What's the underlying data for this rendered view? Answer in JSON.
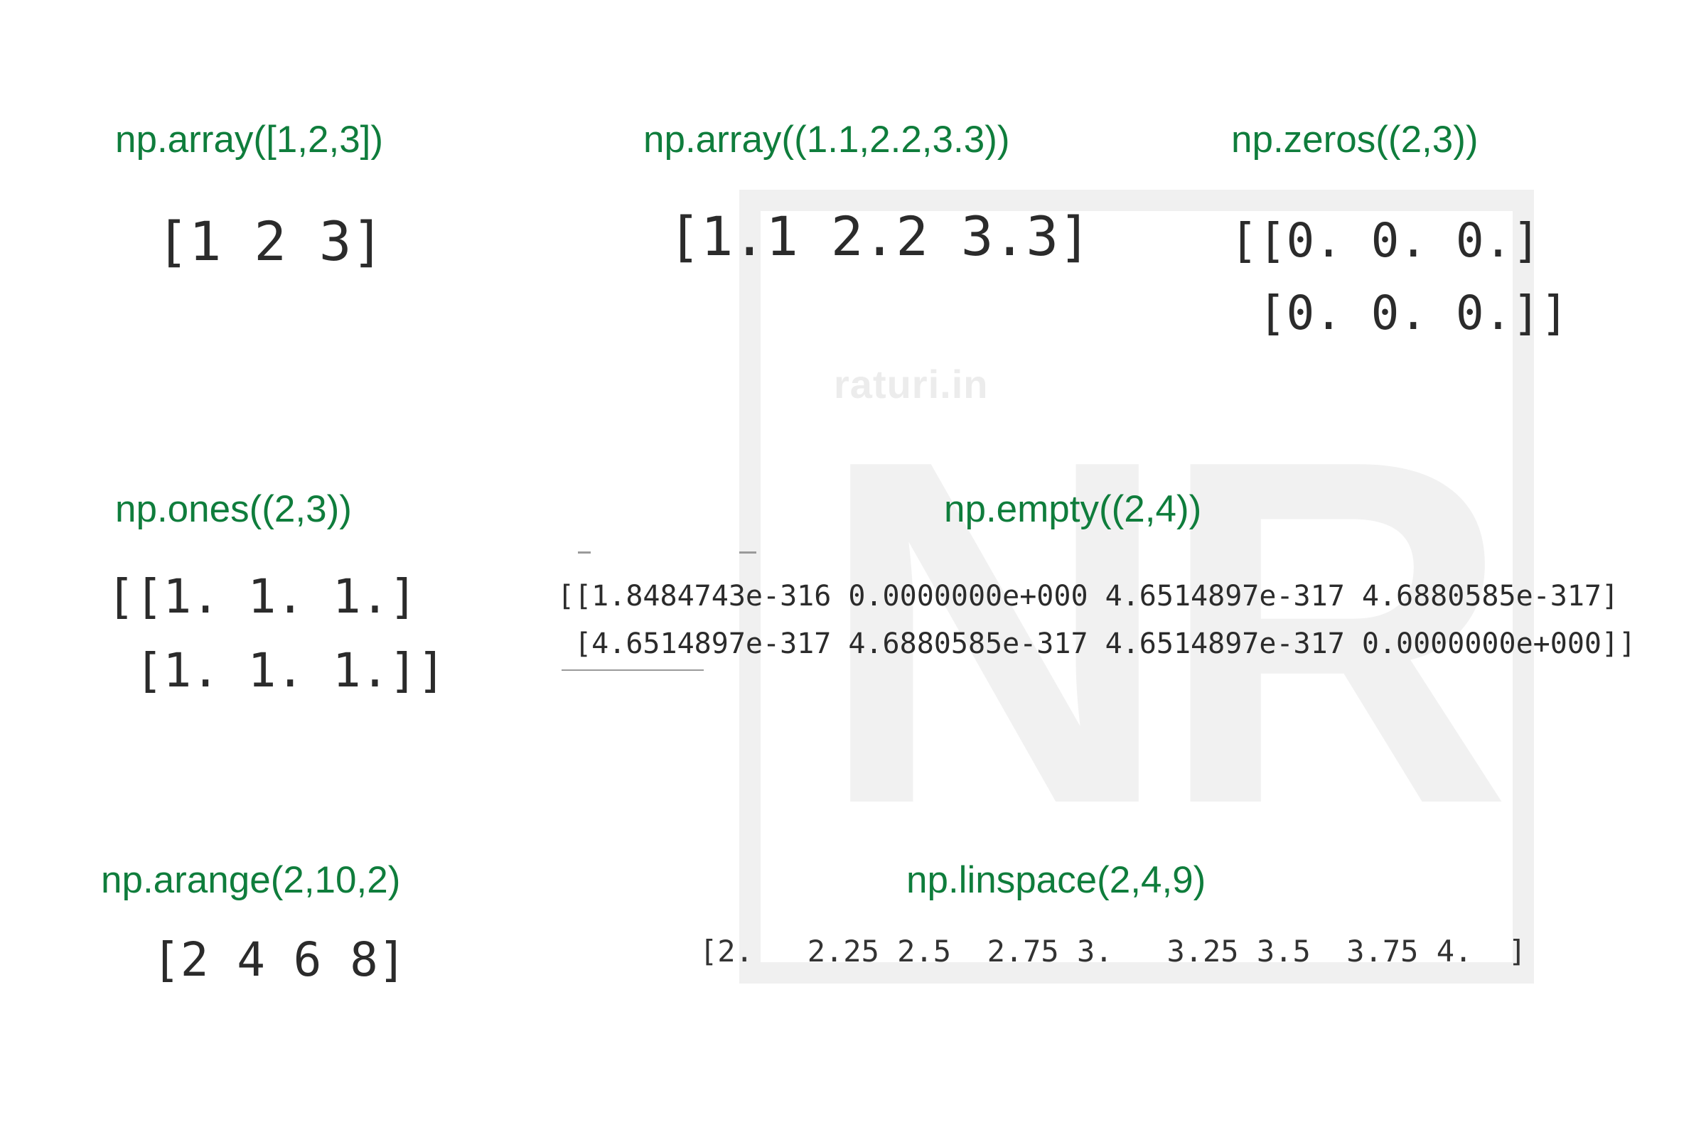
{
  "watermark": {
    "site": "raturi.in",
    "letters": "NR"
  },
  "blocks": {
    "array_int": {
      "label": "np.array([1,2,3])",
      "output": "[1 2 3]"
    },
    "array_float": {
      "label": "np.array((1.1,2.2,3.3))",
      "output": "[1.1 2.2 3.3]"
    },
    "zeros": {
      "label": "np.zeros((2,3))",
      "output": "[[0. 0. 0.]\n [0. 0. 0.]]"
    },
    "ones": {
      "label": "np.ones((2,3))",
      "output": "[[1. 1. 1.]\n [1. 1. 1.]]"
    },
    "empty": {
      "label": "np.empty((2,4))",
      "output": "[[1.8484743e-316 0.0000000e+000 4.6514897e-317 4.6880585e-317]\n [4.6514897e-317 4.6880585e-317 4.6514897e-317 0.0000000e+000]]"
    },
    "arange": {
      "label": "np.arange(2,10,2)",
      "output": "[2 4 6 8]"
    },
    "linspace": {
      "label": "np.linspace(2,4,9)",
      "output": "[2.   2.25 2.5  2.75 3.   3.25 3.5  3.75 4.  ]"
    }
  },
  "colors": {
    "label": "#0f7d3c",
    "output": "#2b2b2b",
    "watermark": "#f0f0f0"
  }
}
